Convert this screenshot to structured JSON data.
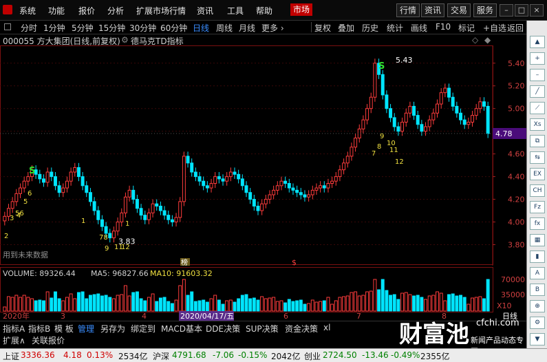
{
  "menu": {
    "items": [
      "系统",
      "功能",
      "报价",
      "分析",
      "扩展市场行情",
      "资讯",
      "工具",
      "帮助"
    ],
    "active": "市场",
    "right_buttons": [
      "行情",
      "资讯",
      "交易",
      "服务"
    ]
  },
  "periods": [
    "分时",
    "1分钟",
    "5分钟",
    "15分钟",
    "30分钟",
    "60分钟",
    "日线",
    "周线",
    "月线",
    "更多 ›"
  ],
  "period_selected": "日线",
  "tools": [
    "复权",
    "叠加",
    "历史",
    "统计",
    "画线",
    "F10",
    "标记",
    "+自选",
    "返回"
  ],
  "title": {
    "stock": "000055 方大集团(日线,前复权)",
    "indicator": "德马克TD指标"
  },
  "chart_data": {
    "type": "candlestick",
    "y_ticks": [
      "5.40",
      "5.20",
      "5.00",
      "4.80",
      "4.60",
      "4.40",
      "4.20",
      "4.00",
      "3.80"
    ],
    "ylim": [
      3.7,
      5.52
    ],
    "x_labels": [
      "2020年",
      "3",
      "4",
      "5",
      "6",
      "7",
      "8"
    ],
    "current_price": "4.78",
    "high_label": "5.43",
    "low_label": "3.83",
    "future_note": "用到未来数据",
    "cursor_date": "2020/04/17/五",
    "period_label": "日线",
    "markers": [
      "榜",
      "$"
    ],
    "td_labels": [
      "S",
      "S",
      "2",
      "3",
      "4",
      "5",
      "6",
      "7",
      "8",
      "9",
      "10",
      "11",
      "12",
      "1",
      "56",
      "78",
      "9",
      "11",
      "12",
      "1"
    ],
    "closes": [
      4.05,
      4.12,
      4.18,
      4.25,
      4.3,
      4.36,
      4.4,
      4.46,
      4.42,
      4.38,
      4.35,
      4.44,
      4.4,
      4.32,
      4.26,
      4.3,
      4.36,
      4.44,
      4.48,
      4.4,
      4.32,
      4.26,
      4.18,
      4.1,
      4.02,
      3.96,
      3.9,
      3.86,
      3.92,
      4.0,
      4.08,
      4.22,
      4.28,
      4.2,
      4.12,
      4.06,
      4.02,
      4.08,
      4.16,
      4.14,
      4.1,
      4.06,
      4.02,
      4.0,
      4.04,
      4.18,
      4.58,
      4.52,
      4.44,
      4.4,
      4.36,
      4.32,
      4.3,
      4.34,
      4.4,
      4.38,
      4.36,
      4.4,
      4.44,
      4.42,
      4.38,
      4.32,
      4.26,
      4.2,
      4.14,
      4.1,
      4.16,
      4.2,
      4.24,
      4.28,
      4.32,
      4.36,
      4.34,
      4.3,
      4.28,
      4.26,
      4.24,
      4.22,
      4.24,
      4.28,
      4.3,
      4.32,
      4.3,
      4.34,
      4.36,
      4.4,
      4.46,
      4.52,
      4.58,
      4.66,
      4.74,
      4.82,
      4.9,
      5.0,
      5.1,
      5.4,
      5.3,
      5.12,
      5.0,
      4.92,
      4.84,
      4.8,
      4.88,
      4.96,
      5.02,
      4.94,
      4.86,
      4.8,
      4.84,
      4.9,
      4.96,
      5.04,
      5.14,
      5.18,
      5.1,
      5.02,
      4.96,
      4.9,
      4.86,
      4.88,
      4.94,
      5.0,
      5.06,
      5.02,
      4.78
    ],
    "volume": {
      "label": "VOLUME: 89326.44",
      "ma5": "MA5: 96827.66",
      "ma10": "MA10: 91603.32",
      "ticks": [
        "70000",
        "35000",
        "X10"
      ]
    }
  },
  "tabs": [
    "指标A",
    "指标B",
    "模 板",
    "管理",
    "另存为",
    "绑定到",
    "MACD基本",
    "DDE决策",
    "SUP决策",
    "资金决策",
    "xl"
  ],
  "tab_selected": "管理",
  "tabs2": [
    "扩展∧",
    "关联报价"
  ],
  "status": {
    "sh_name": "上证",
    "sh_val": "3336.36",
    "sh_chg": "4.18",
    "sh_pct": "0.13%",
    "sh_amt": "2534亿",
    "hs_name": "沪深",
    "hs_val": "4791.68",
    "hs_chg": "-7.06",
    "hs_pct": "-0.15%",
    "hs_amt": "2042亿",
    "cy_name": "创业",
    "cy_val": "2724.50",
    "cy_chg": "-13.46",
    "cy_pct": "-0.49%",
    "cy_amt": "2355亿"
  },
  "watermark": {
    "brand": "财富池",
    "site": "cfchi.com",
    "sub": "新闻产品动态专区"
  },
  "colors": {
    "up": "#ff3c3c",
    "down": "#00e5ff",
    "td": "#f0e040",
    "signal": "#30e030",
    "accent": "#3a8dff"
  }
}
